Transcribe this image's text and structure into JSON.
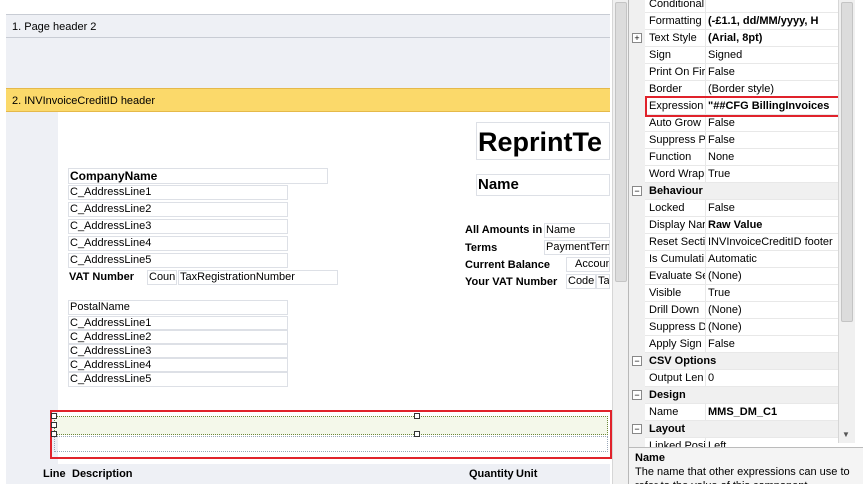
{
  "designer": {
    "bands": {
      "page_header": "1. Page header 2",
      "group_header": "2. INVInvoiceCreditID header"
    },
    "fields": {
      "company_name": "CompanyName",
      "address_lines": [
        "C_AddressLine1",
        "C_AddressLine2",
        "C_AddressLine3",
        "C_AddressLine4",
        "C_AddressLine5"
      ],
      "vat_label": "VAT Number",
      "vat_country": "Coun",
      "vat_number": "TaxRegistrationNumber",
      "postal_name": "PostalName",
      "reprint_title": "ReprintTe",
      "name_title": "Name",
      "all_amounts_label": "All Amounts in",
      "all_amounts_value": "Name",
      "terms_label": "Terms",
      "terms_value": "PaymentTerm",
      "balance_label": "Current Balance",
      "balance_value": "Accoun",
      "your_vat_label": "Your VAT Number",
      "your_vat_code": "Code",
      "your_vat_extra": "Ta"
    },
    "columns": {
      "line": "Line",
      "description": "Description",
      "quantity": "Quantity",
      "unit": "Unit"
    }
  },
  "properties": {
    "rows": [
      {
        "type": "prop",
        "name": "Conditional",
        "value": ""
      },
      {
        "type": "prop",
        "name": "Formatting",
        "value": "(-£1.1, dd/MM/yyyy, H",
        "bold": true
      },
      {
        "type": "prop",
        "name": "Text Style",
        "value": "(Arial, 8pt)",
        "bold": true,
        "expander": "+"
      },
      {
        "type": "prop",
        "name": "Sign",
        "value": "Signed"
      },
      {
        "type": "prop",
        "name": "Print On Fir",
        "value": "False"
      },
      {
        "type": "prop",
        "name": "Border",
        "value": "(Border style)"
      },
      {
        "type": "prop",
        "name": "Expression",
        "value": "\"##CFG BillingInvoices",
        "bold": true,
        "highlight": true
      },
      {
        "type": "prop",
        "name": "Auto Grow",
        "value": "False"
      },
      {
        "type": "prop",
        "name": "Suppress P",
        "value": "False"
      },
      {
        "type": "prop",
        "name": "Function",
        "value": "None"
      },
      {
        "type": "prop",
        "name": "Word Wrap",
        "value": "True"
      },
      {
        "type": "cat",
        "name": "Behaviour",
        "expander": "−"
      },
      {
        "type": "prop",
        "name": "Locked",
        "value": "False"
      },
      {
        "type": "prop",
        "name": "Display Nar",
        "value": "Raw Value",
        "bold": true
      },
      {
        "type": "prop",
        "name": "Reset Secti",
        "value": "INVInvoiceCreditID footer"
      },
      {
        "type": "prop",
        "name": "Is Cumulati",
        "value": "Automatic"
      },
      {
        "type": "prop",
        "name": "Evaluate Se",
        "value": "(None)"
      },
      {
        "type": "prop",
        "name": "Visible",
        "value": "True"
      },
      {
        "type": "prop",
        "name": "Drill Down",
        "value": "(None)"
      },
      {
        "type": "prop",
        "name": "Suppress D",
        "value": "(None)"
      },
      {
        "type": "prop",
        "name": "Apply Sign",
        "value": "False"
      },
      {
        "type": "cat",
        "name": "CSV Options",
        "expander": "−"
      },
      {
        "type": "prop",
        "name": "Output Len",
        "value": "0"
      },
      {
        "type": "cat",
        "name": "Design",
        "expander": "−"
      },
      {
        "type": "prop",
        "name": "Name",
        "value": "MMS_DM_C1",
        "bold": true
      },
      {
        "type": "cat",
        "name": "Layout",
        "expander": "−"
      },
      {
        "type": "prop",
        "name": "Linked Posi",
        "value": "Left"
      }
    ],
    "help": {
      "title": "Name",
      "text": "The name that other expressions can use to refer to the value of this component."
    }
  },
  "colors": {
    "highlight": "#e0222b",
    "group_band": "#fbd96a",
    "band_grey": "#eef0f5"
  }
}
